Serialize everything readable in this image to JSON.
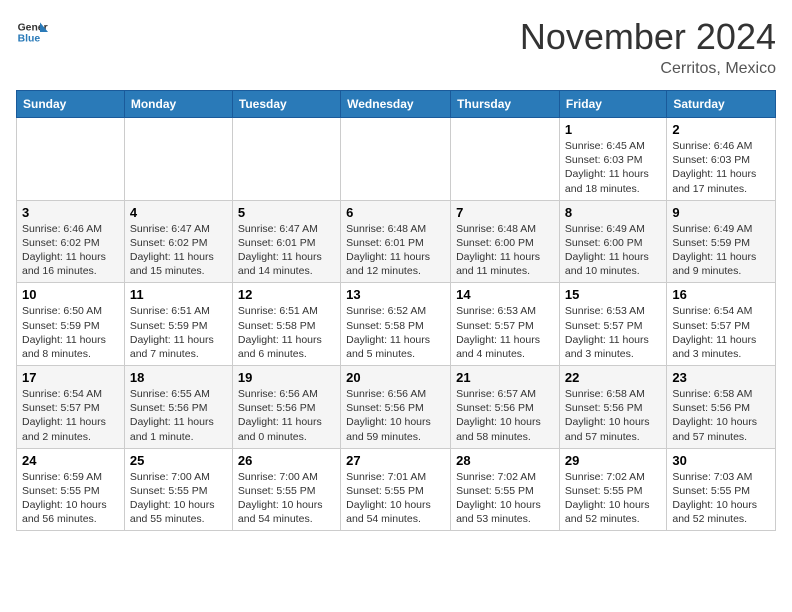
{
  "header": {
    "logo_line1": "General",
    "logo_line2": "Blue",
    "month_title": "November 2024",
    "location": "Cerritos, Mexico"
  },
  "days_of_week": [
    "Sunday",
    "Monday",
    "Tuesday",
    "Wednesday",
    "Thursday",
    "Friday",
    "Saturday"
  ],
  "weeks": [
    [
      {
        "num": "",
        "info": ""
      },
      {
        "num": "",
        "info": ""
      },
      {
        "num": "",
        "info": ""
      },
      {
        "num": "",
        "info": ""
      },
      {
        "num": "",
        "info": ""
      },
      {
        "num": "1",
        "info": "Sunrise: 6:45 AM\nSunset: 6:03 PM\nDaylight: 11 hours and 18 minutes."
      },
      {
        "num": "2",
        "info": "Sunrise: 6:46 AM\nSunset: 6:03 PM\nDaylight: 11 hours and 17 minutes."
      }
    ],
    [
      {
        "num": "3",
        "info": "Sunrise: 6:46 AM\nSunset: 6:02 PM\nDaylight: 11 hours and 16 minutes."
      },
      {
        "num": "4",
        "info": "Sunrise: 6:47 AM\nSunset: 6:02 PM\nDaylight: 11 hours and 15 minutes."
      },
      {
        "num": "5",
        "info": "Sunrise: 6:47 AM\nSunset: 6:01 PM\nDaylight: 11 hours and 14 minutes."
      },
      {
        "num": "6",
        "info": "Sunrise: 6:48 AM\nSunset: 6:01 PM\nDaylight: 11 hours and 12 minutes."
      },
      {
        "num": "7",
        "info": "Sunrise: 6:48 AM\nSunset: 6:00 PM\nDaylight: 11 hours and 11 minutes."
      },
      {
        "num": "8",
        "info": "Sunrise: 6:49 AM\nSunset: 6:00 PM\nDaylight: 11 hours and 10 minutes."
      },
      {
        "num": "9",
        "info": "Sunrise: 6:49 AM\nSunset: 5:59 PM\nDaylight: 11 hours and 9 minutes."
      }
    ],
    [
      {
        "num": "10",
        "info": "Sunrise: 6:50 AM\nSunset: 5:59 PM\nDaylight: 11 hours and 8 minutes."
      },
      {
        "num": "11",
        "info": "Sunrise: 6:51 AM\nSunset: 5:59 PM\nDaylight: 11 hours and 7 minutes."
      },
      {
        "num": "12",
        "info": "Sunrise: 6:51 AM\nSunset: 5:58 PM\nDaylight: 11 hours and 6 minutes."
      },
      {
        "num": "13",
        "info": "Sunrise: 6:52 AM\nSunset: 5:58 PM\nDaylight: 11 hours and 5 minutes."
      },
      {
        "num": "14",
        "info": "Sunrise: 6:53 AM\nSunset: 5:57 PM\nDaylight: 11 hours and 4 minutes."
      },
      {
        "num": "15",
        "info": "Sunrise: 6:53 AM\nSunset: 5:57 PM\nDaylight: 11 hours and 3 minutes."
      },
      {
        "num": "16",
        "info": "Sunrise: 6:54 AM\nSunset: 5:57 PM\nDaylight: 11 hours and 3 minutes."
      }
    ],
    [
      {
        "num": "17",
        "info": "Sunrise: 6:54 AM\nSunset: 5:57 PM\nDaylight: 11 hours and 2 minutes."
      },
      {
        "num": "18",
        "info": "Sunrise: 6:55 AM\nSunset: 5:56 PM\nDaylight: 11 hours and 1 minute."
      },
      {
        "num": "19",
        "info": "Sunrise: 6:56 AM\nSunset: 5:56 PM\nDaylight: 11 hours and 0 minutes."
      },
      {
        "num": "20",
        "info": "Sunrise: 6:56 AM\nSunset: 5:56 PM\nDaylight: 10 hours and 59 minutes."
      },
      {
        "num": "21",
        "info": "Sunrise: 6:57 AM\nSunset: 5:56 PM\nDaylight: 10 hours and 58 minutes."
      },
      {
        "num": "22",
        "info": "Sunrise: 6:58 AM\nSunset: 5:56 PM\nDaylight: 10 hours and 57 minutes."
      },
      {
        "num": "23",
        "info": "Sunrise: 6:58 AM\nSunset: 5:56 PM\nDaylight: 10 hours and 57 minutes."
      }
    ],
    [
      {
        "num": "24",
        "info": "Sunrise: 6:59 AM\nSunset: 5:55 PM\nDaylight: 10 hours and 56 minutes."
      },
      {
        "num": "25",
        "info": "Sunrise: 7:00 AM\nSunset: 5:55 PM\nDaylight: 10 hours and 55 minutes."
      },
      {
        "num": "26",
        "info": "Sunrise: 7:00 AM\nSunset: 5:55 PM\nDaylight: 10 hours and 54 minutes."
      },
      {
        "num": "27",
        "info": "Sunrise: 7:01 AM\nSunset: 5:55 PM\nDaylight: 10 hours and 54 minutes."
      },
      {
        "num": "28",
        "info": "Sunrise: 7:02 AM\nSunset: 5:55 PM\nDaylight: 10 hours and 53 minutes."
      },
      {
        "num": "29",
        "info": "Sunrise: 7:02 AM\nSunset: 5:55 PM\nDaylight: 10 hours and 52 minutes."
      },
      {
        "num": "30",
        "info": "Sunrise: 7:03 AM\nSunset: 5:55 PM\nDaylight: 10 hours and 52 minutes."
      }
    ]
  ]
}
